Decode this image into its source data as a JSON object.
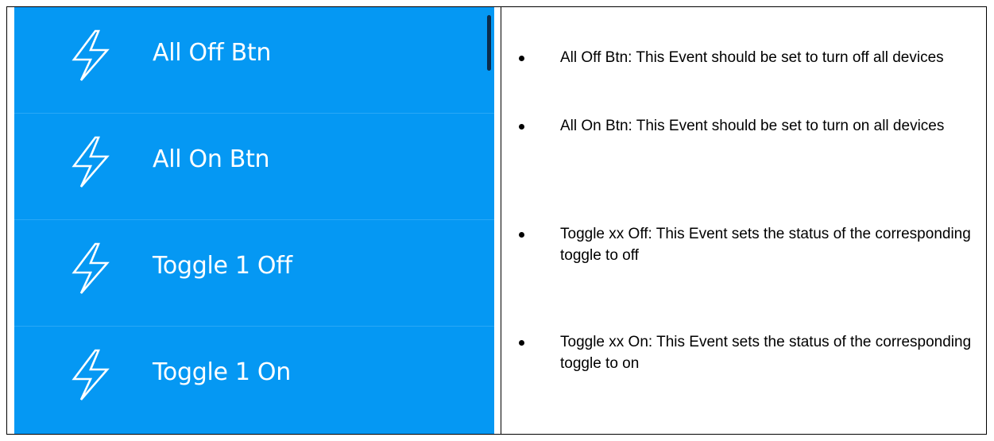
{
  "event_list": {
    "items": [
      {
        "label": "All Off Btn",
        "icon": "lightning-bolt-icon"
      },
      {
        "label": "All On Btn",
        "icon": "lightning-bolt-icon"
      },
      {
        "label": "Toggle 1 Off",
        "icon": "lightning-bolt-icon"
      },
      {
        "label": "Toggle 1 On",
        "icon": "lightning-bolt-icon"
      }
    ],
    "background_color": "#0598f3",
    "text_color": "#ffffff"
  },
  "descriptions": [
    {
      "text": "All Off Btn: This Event should be set to turn off all devices"
    },
    {
      "text": "All On Btn: This Event should be set to turn on all devices"
    },
    {
      "text": "Toggle xx Off: This Event sets the status of the corresponding toggle to off"
    },
    {
      "text": "Toggle xx On: This Event sets the status of the corresponding toggle to on"
    }
  ]
}
